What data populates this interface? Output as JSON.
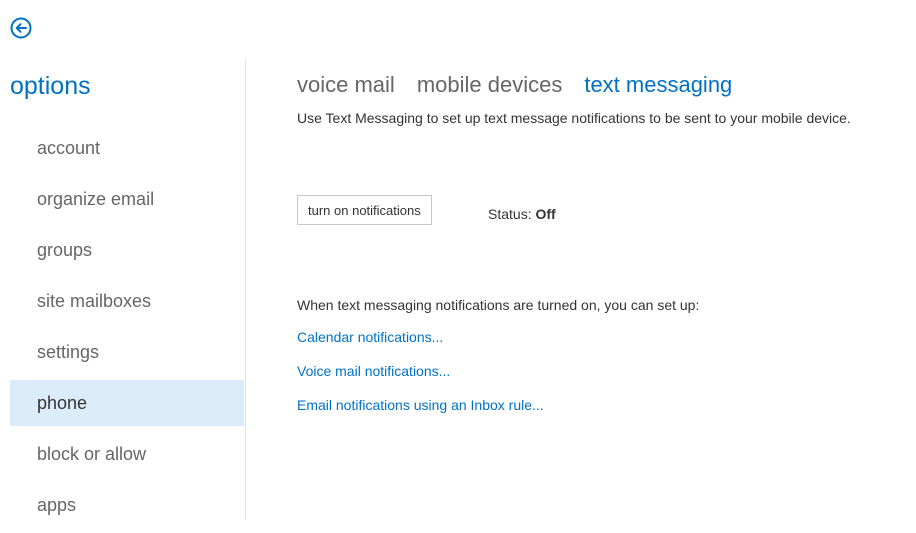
{
  "back": {
    "icon": "back-arrow-icon",
    "color": "#0072c6"
  },
  "sidebar": {
    "title": "options",
    "items": [
      {
        "label": "account",
        "selected": false
      },
      {
        "label": "organize email",
        "selected": false
      },
      {
        "label": "groups",
        "selected": false
      },
      {
        "label": "site mailboxes",
        "selected": false
      },
      {
        "label": "settings",
        "selected": false
      },
      {
        "label": "phone",
        "selected": true
      },
      {
        "label": "block or allow",
        "selected": false
      },
      {
        "label": "apps",
        "selected": false
      }
    ]
  },
  "main": {
    "tabs": [
      {
        "label": "voice mail",
        "active": false
      },
      {
        "label": "mobile devices",
        "active": false
      },
      {
        "label": "text messaging",
        "active": true
      }
    ],
    "intro": "Use Text Messaging to set up text message notifications to be sent to your mobile device.",
    "notify_button": "turn on notifications",
    "status_label": "Status:",
    "status_value": "Off",
    "info": "When text messaging notifications are turned on, you can set up:",
    "links": [
      "Calendar notifications...",
      "Voice mail notifications...",
      "Email notifications using an Inbox rule..."
    ]
  },
  "colors": {
    "accent": "#0072c6",
    "selected_bg": "#dcebf9"
  }
}
